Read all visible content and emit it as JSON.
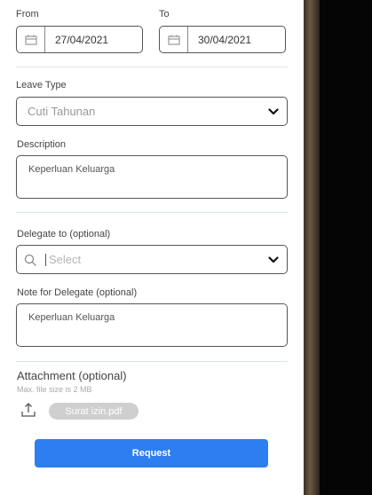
{
  "form": {
    "from_label": "From",
    "to_label": "To",
    "from_date": "27/04/2021",
    "to_date": "30/04/2021",
    "leave_type_label": "Leave Type",
    "leave_type_value": "Cuti Tahunan",
    "description_label": "Description",
    "description_value": "Keperluan Keluarga",
    "delegate_label": "Delegate to (optional)",
    "delegate_placeholder": "Select",
    "delegate_note_label": "Note for Delegate (optional)",
    "delegate_note_value": "Keperluan Keluarga",
    "attachment_label": "Attachment (optional)",
    "attachment_hint": "Max. file size is 2 MB",
    "attachment_file": "Surat izin.pdf",
    "request_button": "Request"
  },
  "colors": {
    "primary_button": "#2d7ef0",
    "divider": "#d8e6f2",
    "file_chip": "#cfcfcf"
  },
  "icons": {
    "calendar": "calendar-icon",
    "chevron": "chevron-down-icon",
    "search": "search-icon",
    "upload": "upload-icon"
  }
}
